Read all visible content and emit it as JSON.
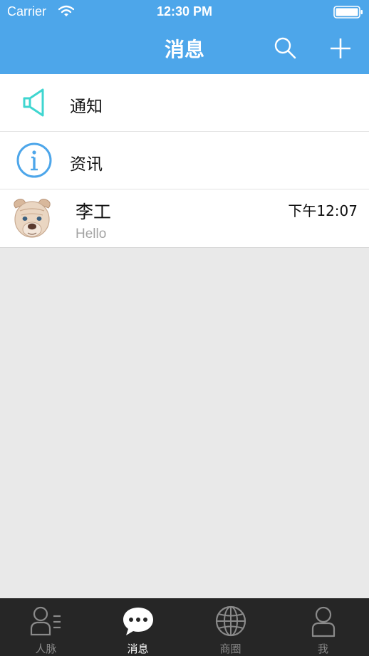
{
  "status_bar": {
    "carrier": "Carrier",
    "time": "12:30 PM"
  },
  "nav": {
    "title": "消息",
    "search_icon": "search-icon",
    "add_icon": "plus-icon"
  },
  "list": {
    "items": [
      {
        "label": "通知",
        "icon": "speaker-icon",
        "icon_color": "#3fd6d0"
      },
      {
        "label": "资讯",
        "icon": "info-icon",
        "icon_color": "#4da6ea"
      }
    ],
    "chats": [
      {
        "name": "李工",
        "time": "下午12:07",
        "preview": "Hello",
        "avatar": "dog-avatar"
      }
    ]
  },
  "tabbar": {
    "tabs": [
      {
        "label": "人脉",
        "icon": "contacts-icon",
        "active": false
      },
      {
        "label": "消息",
        "icon": "chat-bubble-icon",
        "active": true
      },
      {
        "label": "商圈",
        "icon": "globe-icon",
        "active": false
      },
      {
        "label": "我",
        "icon": "person-icon",
        "active": false
      }
    ]
  },
  "colors": {
    "header": "#4da6ea",
    "background": "#e9e9e9",
    "tabbar": "#262626"
  }
}
